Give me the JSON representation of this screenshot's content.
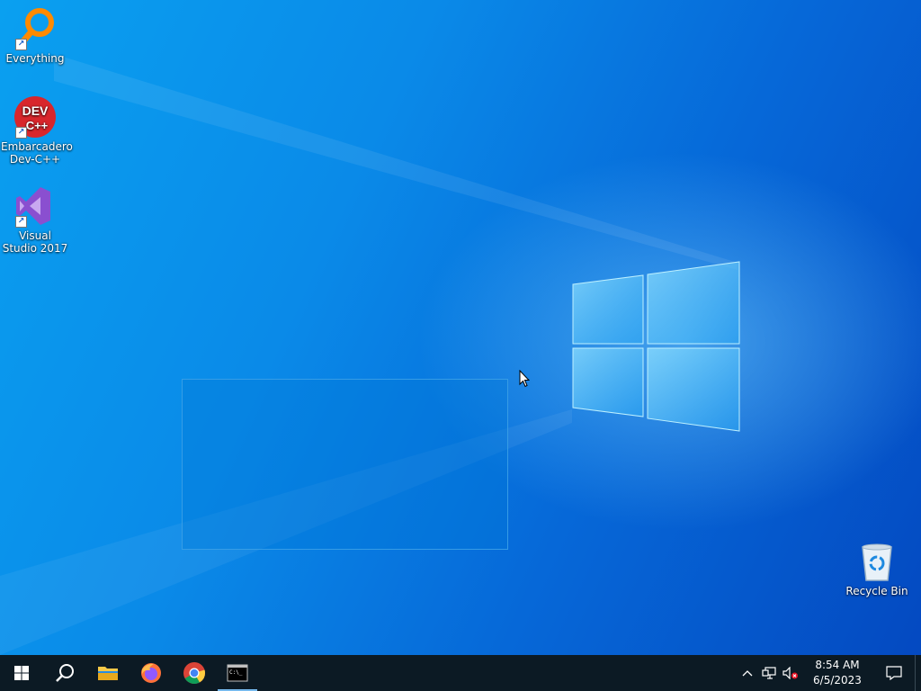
{
  "desktop": {
    "icons": [
      {
        "label": "Everything",
        "icon": "everything-magnifier-icon"
      },
      {
        "label": "Embarcadero Dev-C++",
        "icon": "dev-cpp-icon",
        "icon_text_top": "DEV",
        "icon_text_bottom": "C++"
      },
      {
        "label": "Visual Studio 2017",
        "icon": "visual-studio-icon"
      },
      {
        "label": "Recycle Bin",
        "icon": "recycle-bin-icon"
      }
    ],
    "wallpaper": "windows-10-logo",
    "colors": {
      "accent": "#0078d7",
      "wallpaper_light": "#0aa0f0",
      "wallpaper_dark": "#0448c0"
    }
  },
  "taskbar": {
    "buttons": [
      {
        "name": "start",
        "icon": "windows-start-icon"
      },
      {
        "name": "search",
        "icon": "search-icon"
      },
      {
        "name": "file-explorer",
        "icon": "folder-icon"
      },
      {
        "name": "firefox",
        "icon": "firefox-icon"
      },
      {
        "name": "chrome",
        "icon": "chrome-icon"
      },
      {
        "name": "command-prompt",
        "icon": "cmd-icon",
        "active": true
      }
    ],
    "tray": {
      "overflow_icon": "chevron-up-icon",
      "network_icon": "network-icon",
      "volume_icon": "volume-muted-icon",
      "time": "8:54 AM",
      "date": "6/5/2023",
      "notifications_icon": "action-center-icon"
    }
  }
}
